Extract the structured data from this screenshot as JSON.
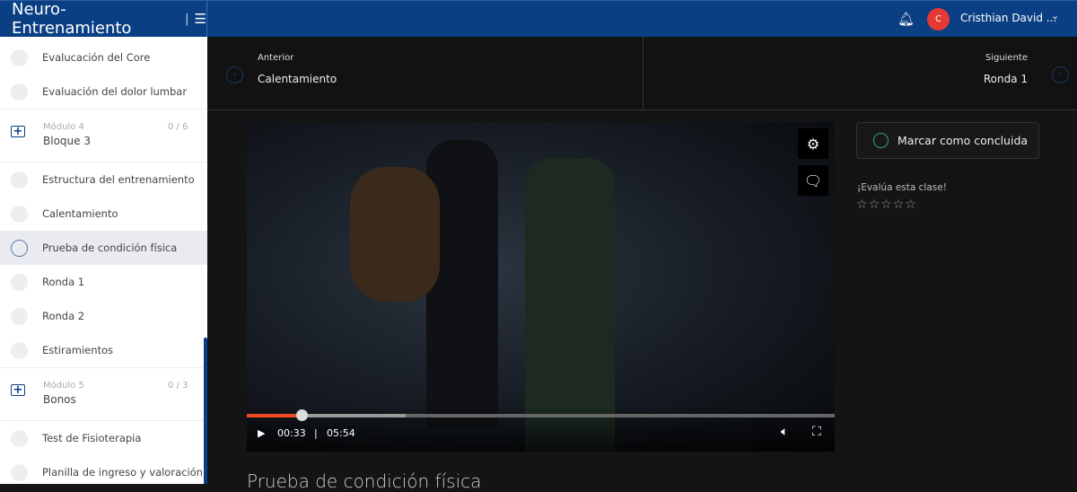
{
  "header": {
    "brand": "Neuro-Entrenamiento",
    "separator": "|",
    "menu_icon": "hamburger-icon",
    "user_initial": "C",
    "user_name": "Cristhian David ..."
  },
  "sidebar": {
    "items_top": [
      {
        "label": "Evalucación del Core"
      },
      {
        "label": "Evaluación del dolor lumbar"
      }
    ],
    "module4": {
      "label": "Módulo 4",
      "count": "0 / 6",
      "name": "Bloque 3"
    },
    "items_mid": [
      {
        "label": "Estructura del entrenamiento"
      },
      {
        "label": "Calentamiento"
      },
      {
        "label": "Prueba de condición física",
        "active": true
      },
      {
        "label": "Ronda 1"
      },
      {
        "label": "Ronda 2"
      },
      {
        "label": "Estiramientos"
      }
    ],
    "module5": {
      "label": "Módulo 5",
      "count": "0 / 3",
      "name": "Bonos"
    },
    "items_bottom": [
      {
        "label": "Test de Fisioterapia"
      },
      {
        "label": "Planilla de ingreso y valoración"
      }
    ]
  },
  "nav": {
    "prev_label": "Anterior",
    "prev_title": "Calentamiento",
    "next_label": "Siguiente",
    "next_title": "Ronda 1"
  },
  "video": {
    "current": "00:33",
    "separator": "|",
    "duration": "05:54",
    "progress_percent": 9.3,
    "buffered_percent": 27
  },
  "lesson": {
    "complete_label": "Marcar como concluida",
    "rate_label": "¡Evalúa esta clase!",
    "rating": 0,
    "max_rating": 5,
    "title": "Prueba de condición física"
  },
  "colors": {
    "brand": "#0b3f84",
    "progress": "#f04a24",
    "complete": "#2ea66a"
  }
}
